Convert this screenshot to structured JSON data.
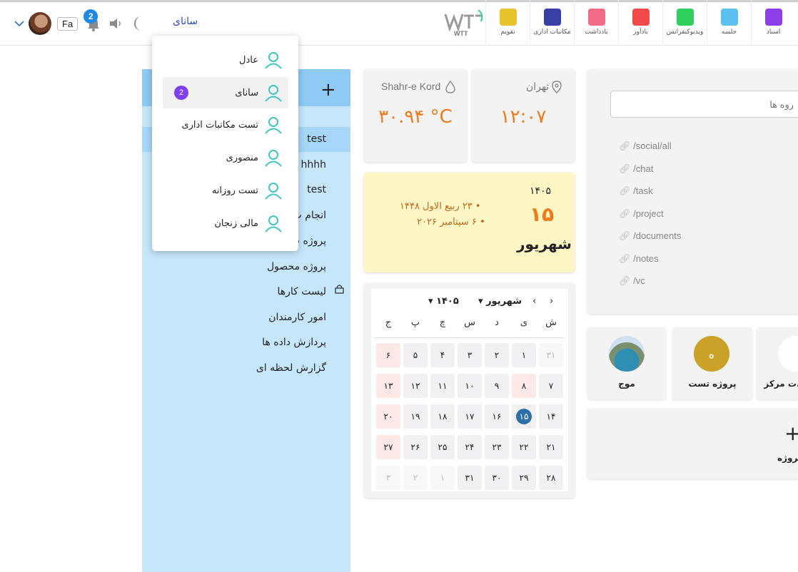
{
  "header": {
    "language": "Fa",
    "notification_count": "2",
    "user_name": "سانای",
    "logo_text": "WTT",
    "apps": [
      {
        "label": "تقویم",
        "color": "#e6c22b",
        "icon": "calendar-icon"
      },
      {
        "label": "مکاتبات اداری",
        "color": "#3a3fa6",
        "icon": "mail-icon"
      },
      {
        "label": "یادداشت",
        "color": "#f06b86",
        "icon": "note-icon"
      },
      {
        "label": "یادآور",
        "color": "#f04b4b",
        "icon": "alarm-icon"
      },
      {
        "label": "ویدیوکنفرانس",
        "color": "#2fcf5e",
        "icon": "video-icon"
      },
      {
        "label": "جلسه",
        "color": "#5bc0f0",
        "icon": "meeting-icon"
      },
      {
        "label": "اسناد",
        "color": "#8e3ee6",
        "icon": "folder-icon"
      }
    ]
  },
  "user_menu": {
    "items": [
      {
        "label": "عادل"
      },
      {
        "label": "سانای",
        "badge": "2"
      },
      {
        "label": "تست مکاتبات اداری"
      },
      {
        "label": "منصوری"
      },
      {
        "label": "تست روزانه"
      },
      {
        "label": "مالی زنجان"
      }
    ]
  },
  "tasks_panel": {
    "rows": [
      "test",
      "hhhh",
      "test",
      "انجام پ",
      "پروژه ت",
      "پروژه محصول",
      "لیست کارها",
      "امور کارمندان",
      "پردازش داده ها",
      "گزارش لحظه ای"
    ]
  },
  "weather": {
    "left_city": "Shahr-e Kord",
    "left_value": "۳۰.۹۴ °C",
    "right_city": "تهران",
    "right_value": "۱۲:۰۷"
  },
  "date_card": {
    "year": "۱۴۰۵",
    "day": "۱۵",
    "month": "شهریور",
    "hijri": "۲۳ ربیع الاول ۱۴۴۸",
    "gregorian": "۶ سپتامبر ۲۰۲۶"
  },
  "calendar": {
    "month": "شهریور",
    "year": "۱۴۰۵",
    "weekdays": [
      "ش",
      "ی",
      "د",
      "س",
      "چ",
      "پ",
      "ج"
    ],
    "weeks": [
      [
        "۳۱",
        "۱",
        "۲",
        "۳",
        "۴",
        "۵",
        "۶"
      ],
      [
        "۷",
        "۸",
        "۹",
        "۱۰",
        "۱۱",
        "۱۲",
        "۱۳"
      ],
      [
        "۱۴",
        "۱۵",
        "۱۶",
        "۱۷",
        "۱۸",
        "۱۹",
        "۲۰"
      ],
      [
        "۲۱",
        "۲۲",
        "۲۳",
        "۲۴",
        "۲۵",
        "۲۶",
        "۲۷"
      ],
      [
        "۲۸",
        "۲۹",
        "۳۰",
        "۳۱",
        "۱",
        "۲",
        "۳"
      ]
    ]
  },
  "search": {
    "placeholder": "روه ها"
  },
  "links": [
    "/social/all",
    "/chat",
    "/task",
    "/project",
    "/documents",
    "/notes",
    "/vc"
  ],
  "projects": [
    {
      "label": "موج"
    },
    {
      "label": "پروژه تست",
      "initial": "ه"
    },
    {
      "label": "ت مرکز..."
    }
  ],
  "new_project_label": "پروژه"
}
